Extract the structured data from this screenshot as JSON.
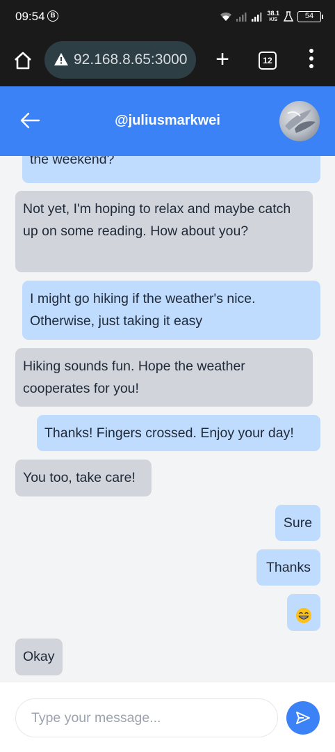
{
  "status_bar": {
    "time": "09:54",
    "notification_badge": "B",
    "network_speed_value": "38.1",
    "network_speed_unit": "K/S",
    "battery_level": "54"
  },
  "browser": {
    "url": "92.168.8.65:3000",
    "tab_count": "12",
    "new_tab_label": "+"
  },
  "header": {
    "title": "@juliusmarkwei"
  },
  "messages": [
    {
      "side": "sent",
      "text": "the weekend?"
    },
    {
      "side": "received",
      "text": "Not yet, I'm hoping to relax and maybe catch up on some reading. How about you?"
    },
    {
      "side": "sent",
      "text": "I might go hiking if the weather's nice. Otherwise, just taking it easy"
    },
    {
      "side": "received",
      "text": "Hiking sounds fun. Hope the weather cooperates for you!"
    },
    {
      "side": "sent",
      "text": "Thanks! Fingers crossed. Enjoy your day!"
    },
    {
      "side": "received",
      "text": "You too, take care!"
    },
    {
      "side": "sent",
      "text": "Sure"
    },
    {
      "side": "sent",
      "text": "Thanks"
    },
    {
      "side": "sent",
      "text": "😁",
      "icon": "grinning-face-emoji"
    },
    {
      "side": "received",
      "text": "Okay"
    }
  ],
  "composer": {
    "placeholder": "Type your message...",
    "value": ""
  },
  "colors": {
    "header": "#3b82f6",
    "sent_bubble": "#bfdbfe",
    "received_bubble": "#d1d5db",
    "chat_background": "#f3f4f6",
    "send_button": "#3b82f6"
  }
}
